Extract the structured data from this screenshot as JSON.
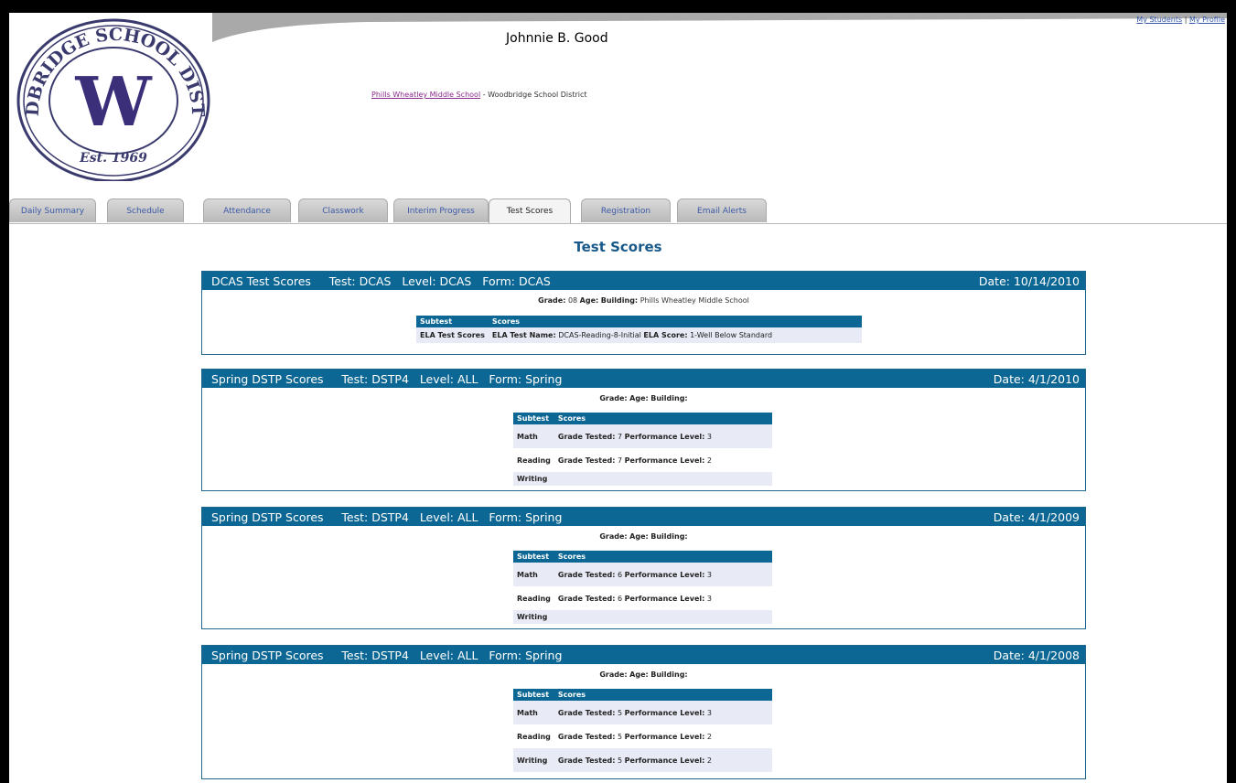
{
  "header": {
    "top_links": {
      "my_students": "My Students",
      "separator": "|",
      "my_profile": "My Profile"
    },
    "logo": {
      "ring_text": "WOODBRIDGE SCHOOL DISTRICT",
      "letter": "W",
      "est": "Est. 1969"
    },
    "student_name": "Johnnie B. Good",
    "school_link": "Phills Wheatley Middle School",
    "district_text": " - Woodbridge School District"
  },
  "tabs": [
    {
      "label": "Daily Summary"
    },
    {
      "label": "Schedule"
    },
    {
      "label": "Attendance"
    },
    {
      "label": "Classwork"
    },
    {
      "label": "Interim Progress"
    },
    {
      "label": "Test Scores"
    },
    {
      "label": "Registration"
    },
    {
      "label": "Email Alerts"
    }
  ],
  "active_tab": "Test Scores",
  "page_title": "Test Scores",
  "labels": {
    "grade": "Grade:",
    "age": "Age:",
    "building": "Building:",
    "subtest": "Subtest",
    "scores": "Scores",
    "grade_tested": "Grade Tested:",
    "performance_level": "Performance Level:"
  },
  "panels": [
    {
      "title": "DCAS Test Scores     Test: DCAS   Level: DCAS   Form: DCAS",
      "date": "Date: 10/14/2010",
      "grade": "08",
      "age": "",
      "building": "Phills Wheatley Middle School",
      "rows": [
        {
          "name": "ELA Test Scores",
          "l1": "ELA Test Name:",
          "v1": "DCAS-Reading-8-Initial",
          "l2": "ELA Score:",
          "v2": "1-Well Below Standard"
        }
      ]
    },
    {
      "title": "Spring DSTP Scores     Test: DSTP4   Level: ALL   Form: Spring",
      "date": "Date: 4/1/2010",
      "grade": "",
      "age": "",
      "building": "",
      "rows": [
        {
          "name": "Math",
          "l1": "Grade Tested:",
          "v1": "7",
          "l2": "Performance Level:",
          "v2": "3"
        },
        {
          "name": "Reading",
          "l1": "Grade Tested:",
          "v1": "7",
          "l2": "Performance Level:",
          "v2": "2"
        },
        {
          "name": "Writing",
          "l1": "",
          "v1": "",
          "l2": "",
          "v2": ""
        }
      ]
    },
    {
      "title": "Spring DSTP Scores     Test: DSTP4   Level: ALL   Form: Spring",
      "date": "Date: 4/1/2009",
      "grade": "",
      "age": "",
      "building": "",
      "rows": [
        {
          "name": "Math",
          "l1": "Grade Tested:",
          "v1": "6",
          "l2": "Performance Level:",
          "v2": "3"
        },
        {
          "name": "Reading",
          "l1": "Grade Tested:",
          "v1": "6",
          "l2": "Performance Level:",
          "v2": "3"
        },
        {
          "name": "Writing",
          "l1": "",
          "v1": "",
          "l2": "",
          "v2": ""
        }
      ]
    },
    {
      "title": "Spring DSTP Scores     Test: DSTP4   Level: ALL   Form: Spring",
      "date": "Date: 4/1/2008",
      "grade": "",
      "age": "",
      "building": "",
      "rows": [
        {
          "name": "Math",
          "l1": "Grade Tested:",
          "v1": "5",
          "l2": "Performance Level:",
          "v2": "3"
        },
        {
          "name": "Reading",
          "l1": "Grade Tested:",
          "v1": "5",
          "l2": "Performance Level:",
          "v2": "2"
        },
        {
          "name": "Writing",
          "l1": "Grade Tested:",
          "v1": "5",
          "l2": "Performance Level:",
          "v2": "2"
        }
      ]
    }
  ],
  "colors": {
    "header_blue": "#0d6794",
    "link_purple": "#8a2a8a",
    "heading_blue": "#1a5a8a"
  }
}
